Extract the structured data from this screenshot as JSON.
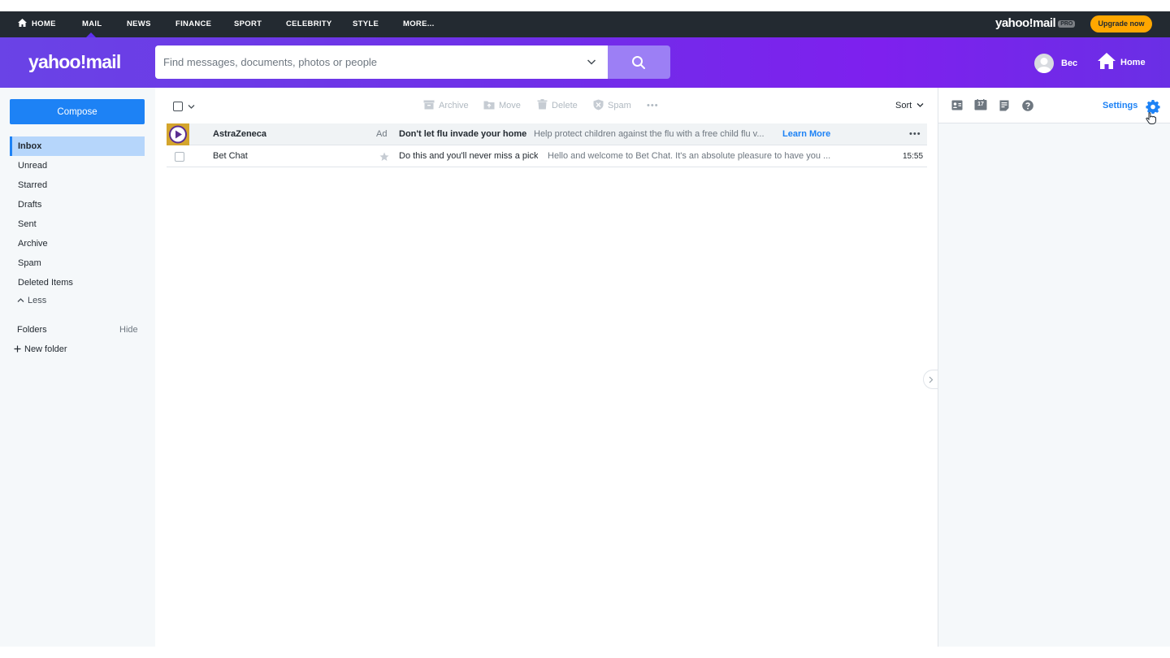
{
  "topnav": {
    "items": [
      "HOME",
      "MAIL",
      "NEWS",
      "FINANCE",
      "SPORT",
      "CELEBRITY",
      "STYLE",
      "MORE..."
    ],
    "logo": "yahoo!mail",
    "pro_badge": "PRO",
    "upgrade_label": "Upgrade now"
  },
  "header": {
    "logo": "yahoo!mail",
    "search_placeholder": "Find messages, documents, photos or people",
    "user_name": "Bec",
    "home_label": "Home"
  },
  "sidebar": {
    "compose_label": "Compose",
    "items": [
      "Inbox",
      "Unread",
      "Starred",
      "Drafts",
      "Sent",
      "Archive",
      "Spam",
      "Deleted Items"
    ],
    "active_item": "Inbox",
    "less_label": "Less",
    "folders_label": "Folders",
    "hide_label": "Hide",
    "new_folder_label": "New folder"
  },
  "toolbar": {
    "archive": "Archive",
    "move": "Move",
    "delete": "Delete",
    "spam": "Spam",
    "more": "•••",
    "sort": "Sort"
  },
  "messages": [
    {
      "sender": "AstraZeneca",
      "ad_label": "Ad",
      "subject": "Don't let flu invade your home",
      "snippet": "Help protect children against the flu with a free child flu v...",
      "cta": "Learn More",
      "more": "•••"
    },
    {
      "sender": "Bet Chat",
      "subject": "Do this and you'll never miss a pick",
      "snippet": "Hello and welcome to Bet Chat. It's an absolute pleasure to have you ...",
      "time": "15:55"
    }
  ],
  "right_pane": {
    "calendar_day": "17",
    "settings_label": "Settings"
  },
  "colors": {
    "accent": "#1d82f5",
    "header_purple": "#6f2fe8",
    "upgrade": "#ffa700",
    "nav_dark": "#232a31"
  }
}
